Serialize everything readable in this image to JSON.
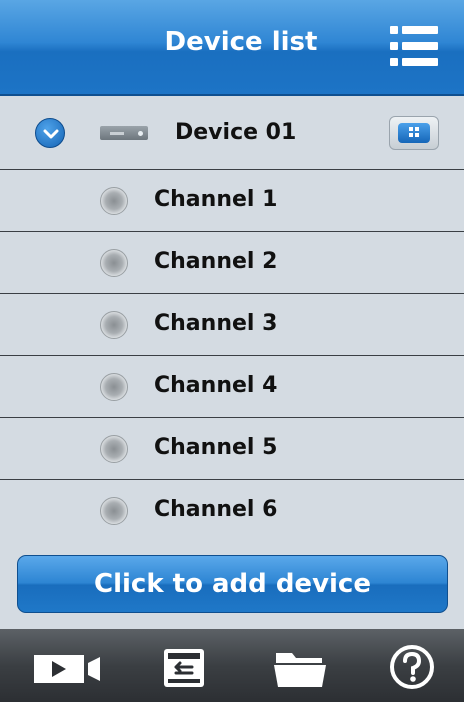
{
  "header": {
    "title": "Device list",
    "menu_icon": "list-menu-icon"
  },
  "device": {
    "name": "Device 01",
    "expand_icon": "chevron-down-icon",
    "type_icon": "dvr-icon",
    "view_icon": "grid-view-icon"
  },
  "channels": [
    {
      "label": "Channel 1"
    },
    {
      "label": "Channel 2"
    },
    {
      "label": "Channel 3"
    },
    {
      "label": "Channel 4"
    },
    {
      "label": "Channel 5"
    },
    {
      "label": "Channel 6"
    }
  ],
  "add_button": {
    "label": "Click to add device"
  },
  "toolbar": {
    "items": [
      "live-view-icon",
      "playback-icon",
      "folder-icon",
      "help-icon"
    ]
  },
  "colors": {
    "accent": "#2f86d4",
    "background": "#d4dbe2",
    "toolbar": "#3b3f43"
  }
}
